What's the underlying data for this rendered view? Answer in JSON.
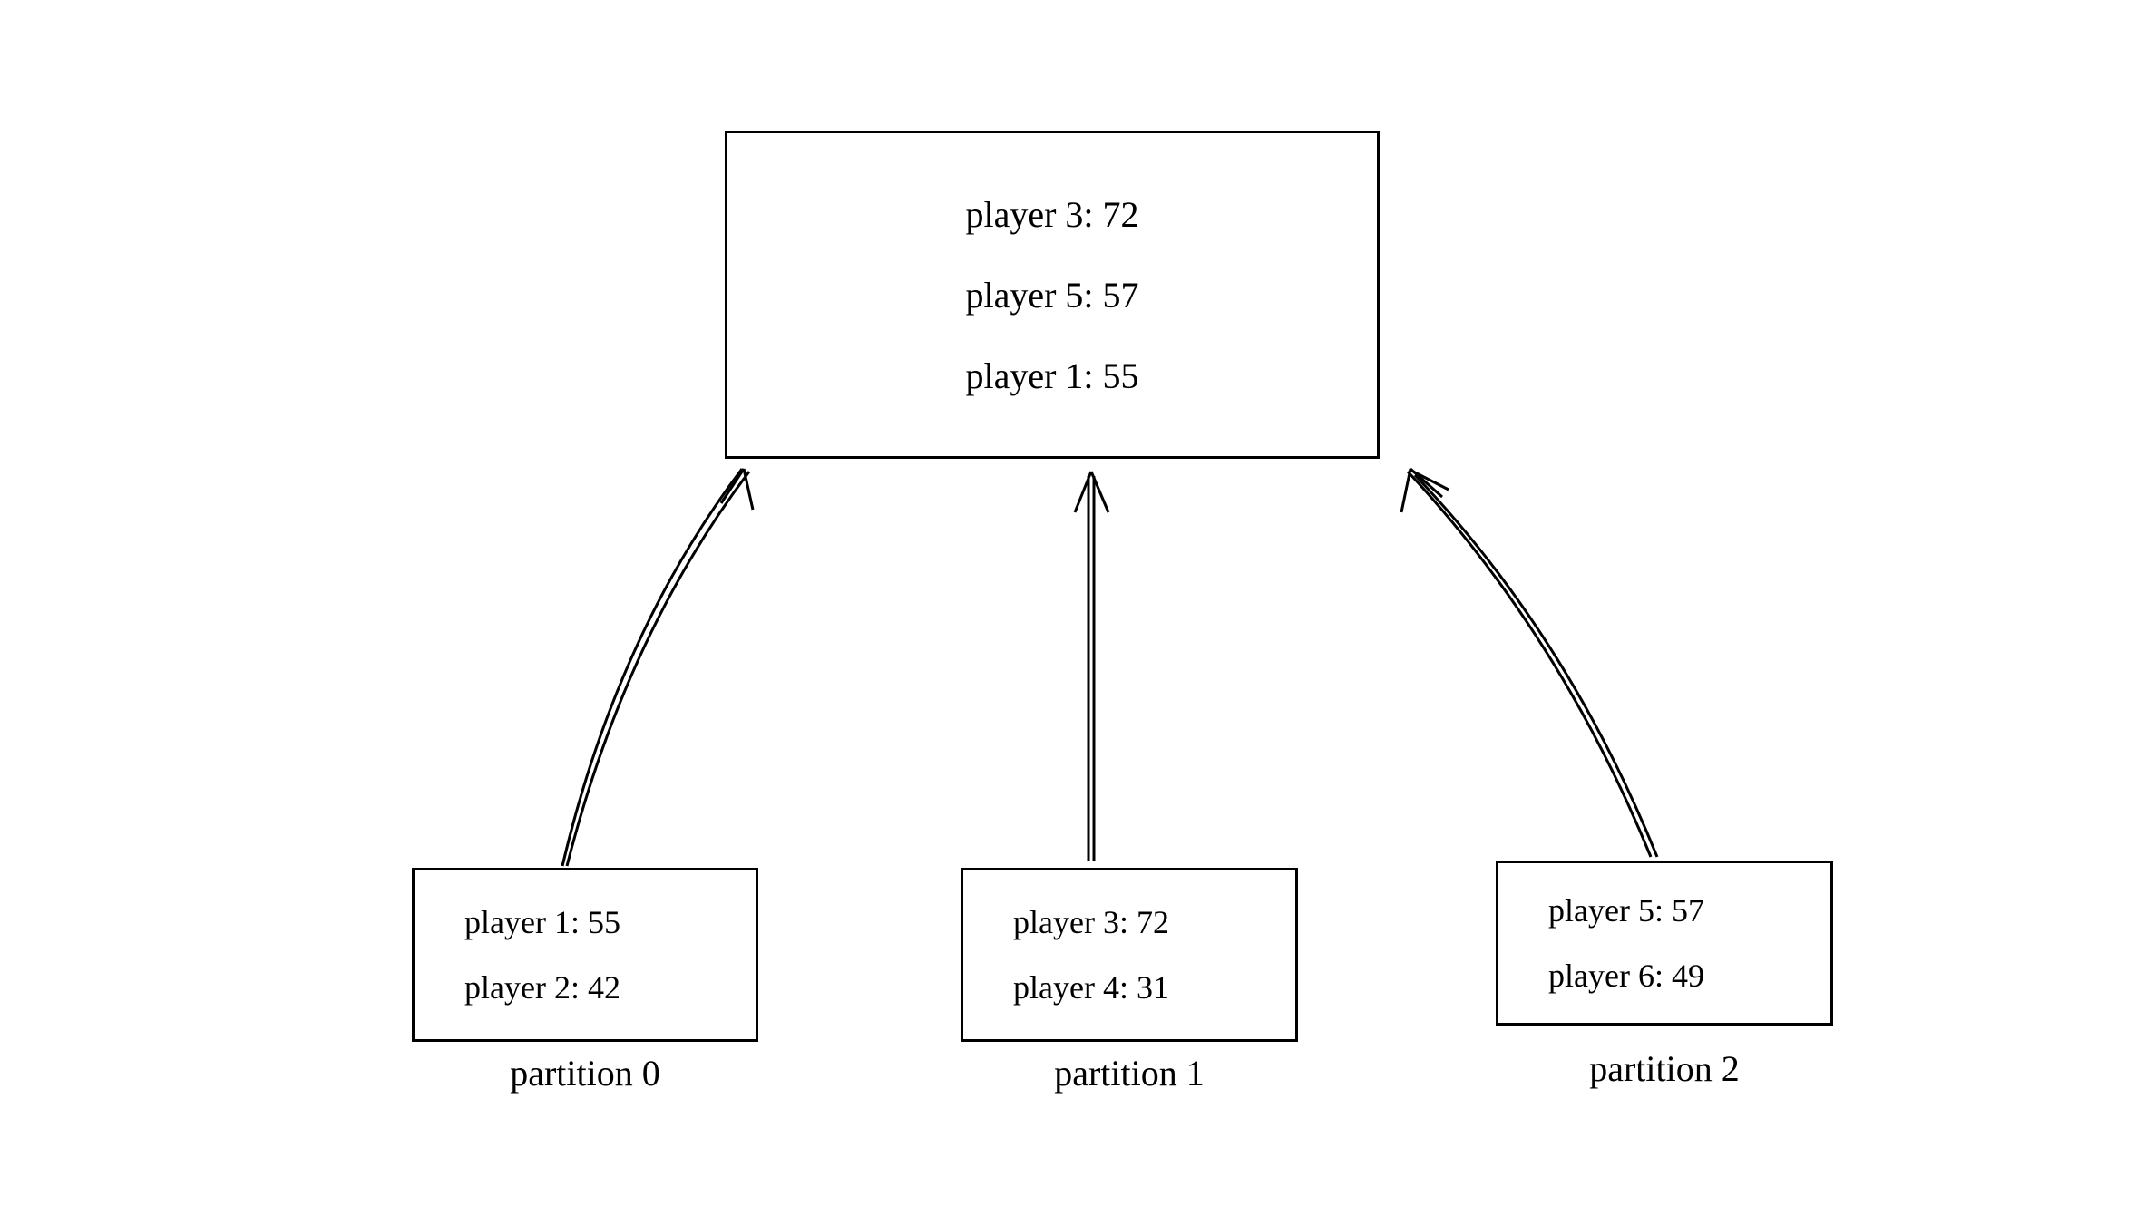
{
  "aggregate": {
    "rows": [
      {
        "label": "player 3",
        "score": 72
      },
      {
        "label": "player 5",
        "score": 57
      },
      {
        "label": "player 1",
        "score": 55
      }
    ]
  },
  "partitions": [
    {
      "name": "partition 0",
      "rows": [
        {
          "label": "player 1",
          "score": 55
        },
        {
          "label": "player 2",
          "score": 42
        }
      ]
    },
    {
      "name": "partition 1",
      "rows": [
        {
          "label": "player 3",
          "score": 72
        },
        {
          "label": "player 4",
          "score": 31
        }
      ]
    },
    {
      "name": "partition 2",
      "rows": [
        {
          "label": "player 5",
          "score": 57
        },
        {
          "label": "player 6",
          "score": 49
        }
      ]
    }
  ]
}
